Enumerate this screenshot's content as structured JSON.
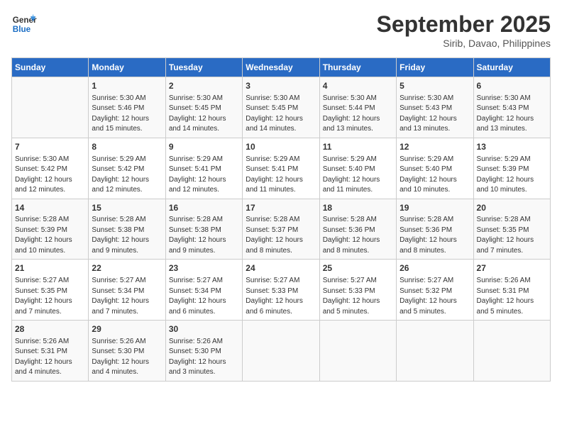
{
  "header": {
    "logo_line1": "General",
    "logo_line2": "Blue",
    "month": "September 2025",
    "location": "Sirib, Davao, Philippines"
  },
  "days_of_week": [
    "Sunday",
    "Monday",
    "Tuesday",
    "Wednesday",
    "Thursday",
    "Friday",
    "Saturday"
  ],
  "weeks": [
    [
      {
        "num": "",
        "lines": []
      },
      {
        "num": "1",
        "lines": [
          "Sunrise: 5:30 AM",
          "Sunset: 5:46 PM",
          "Daylight: 12 hours",
          "and 15 minutes."
        ]
      },
      {
        "num": "2",
        "lines": [
          "Sunrise: 5:30 AM",
          "Sunset: 5:45 PM",
          "Daylight: 12 hours",
          "and 14 minutes."
        ]
      },
      {
        "num": "3",
        "lines": [
          "Sunrise: 5:30 AM",
          "Sunset: 5:45 PM",
          "Daylight: 12 hours",
          "and 14 minutes."
        ]
      },
      {
        "num": "4",
        "lines": [
          "Sunrise: 5:30 AM",
          "Sunset: 5:44 PM",
          "Daylight: 12 hours",
          "and 13 minutes."
        ]
      },
      {
        "num": "5",
        "lines": [
          "Sunrise: 5:30 AM",
          "Sunset: 5:43 PM",
          "Daylight: 12 hours",
          "and 13 minutes."
        ]
      },
      {
        "num": "6",
        "lines": [
          "Sunrise: 5:30 AM",
          "Sunset: 5:43 PM",
          "Daylight: 12 hours",
          "and 13 minutes."
        ]
      }
    ],
    [
      {
        "num": "7",
        "lines": [
          "Sunrise: 5:30 AM",
          "Sunset: 5:42 PM",
          "Daylight: 12 hours",
          "and 12 minutes."
        ]
      },
      {
        "num": "8",
        "lines": [
          "Sunrise: 5:29 AM",
          "Sunset: 5:42 PM",
          "Daylight: 12 hours",
          "and 12 minutes."
        ]
      },
      {
        "num": "9",
        "lines": [
          "Sunrise: 5:29 AM",
          "Sunset: 5:41 PM",
          "Daylight: 12 hours",
          "and 12 minutes."
        ]
      },
      {
        "num": "10",
        "lines": [
          "Sunrise: 5:29 AM",
          "Sunset: 5:41 PM",
          "Daylight: 12 hours",
          "and 11 minutes."
        ]
      },
      {
        "num": "11",
        "lines": [
          "Sunrise: 5:29 AM",
          "Sunset: 5:40 PM",
          "Daylight: 12 hours",
          "and 11 minutes."
        ]
      },
      {
        "num": "12",
        "lines": [
          "Sunrise: 5:29 AM",
          "Sunset: 5:40 PM",
          "Daylight: 12 hours",
          "and 10 minutes."
        ]
      },
      {
        "num": "13",
        "lines": [
          "Sunrise: 5:29 AM",
          "Sunset: 5:39 PM",
          "Daylight: 12 hours",
          "and 10 minutes."
        ]
      }
    ],
    [
      {
        "num": "14",
        "lines": [
          "Sunrise: 5:28 AM",
          "Sunset: 5:39 PM",
          "Daylight: 12 hours",
          "and 10 minutes."
        ]
      },
      {
        "num": "15",
        "lines": [
          "Sunrise: 5:28 AM",
          "Sunset: 5:38 PM",
          "Daylight: 12 hours",
          "and 9 minutes."
        ]
      },
      {
        "num": "16",
        "lines": [
          "Sunrise: 5:28 AM",
          "Sunset: 5:38 PM",
          "Daylight: 12 hours",
          "and 9 minutes."
        ]
      },
      {
        "num": "17",
        "lines": [
          "Sunrise: 5:28 AM",
          "Sunset: 5:37 PM",
          "Daylight: 12 hours",
          "and 8 minutes."
        ]
      },
      {
        "num": "18",
        "lines": [
          "Sunrise: 5:28 AM",
          "Sunset: 5:36 PM",
          "Daylight: 12 hours",
          "and 8 minutes."
        ]
      },
      {
        "num": "19",
        "lines": [
          "Sunrise: 5:28 AM",
          "Sunset: 5:36 PM",
          "Daylight: 12 hours",
          "and 8 minutes."
        ]
      },
      {
        "num": "20",
        "lines": [
          "Sunrise: 5:28 AM",
          "Sunset: 5:35 PM",
          "Daylight: 12 hours",
          "and 7 minutes."
        ]
      }
    ],
    [
      {
        "num": "21",
        "lines": [
          "Sunrise: 5:27 AM",
          "Sunset: 5:35 PM",
          "Daylight: 12 hours",
          "and 7 minutes."
        ]
      },
      {
        "num": "22",
        "lines": [
          "Sunrise: 5:27 AM",
          "Sunset: 5:34 PM",
          "Daylight: 12 hours",
          "and 7 minutes."
        ]
      },
      {
        "num": "23",
        "lines": [
          "Sunrise: 5:27 AM",
          "Sunset: 5:34 PM",
          "Daylight: 12 hours",
          "and 6 minutes."
        ]
      },
      {
        "num": "24",
        "lines": [
          "Sunrise: 5:27 AM",
          "Sunset: 5:33 PM",
          "Daylight: 12 hours",
          "and 6 minutes."
        ]
      },
      {
        "num": "25",
        "lines": [
          "Sunrise: 5:27 AM",
          "Sunset: 5:33 PM",
          "Daylight: 12 hours",
          "and 5 minutes."
        ]
      },
      {
        "num": "26",
        "lines": [
          "Sunrise: 5:27 AM",
          "Sunset: 5:32 PM",
          "Daylight: 12 hours",
          "and 5 minutes."
        ]
      },
      {
        "num": "27",
        "lines": [
          "Sunrise: 5:26 AM",
          "Sunset: 5:31 PM",
          "Daylight: 12 hours",
          "and 5 minutes."
        ]
      }
    ],
    [
      {
        "num": "28",
        "lines": [
          "Sunrise: 5:26 AM",
          "Sunset: 5:31 PM",
          "Daylight: 12 hours",
          "and 4 minutes."
        ]
      },
      {
        "num": "29",
        "lines": [
          "Sunrise: 5:26 AM",
          "Sunset: 5:30 PM",
          "Daylight: 12 hours",
          "and 4 minutes."
        ]
      },
      {
        "num": "30",
        "lines": [
          "Sunrise: 5:26 AM",
          "Sunset: 5:30 PM",
          "Daylight: 12 hours",
          "and 3 minutes."
        ]
      },
      {
        "num": "",
        "lines": []
      },
      {
        "num": "",
        "lines": []
      },
      {
        "num": "",
        "lines": []
      },
      {
        "num": "",
        "lines": []
      }
    ]
  ]
}
